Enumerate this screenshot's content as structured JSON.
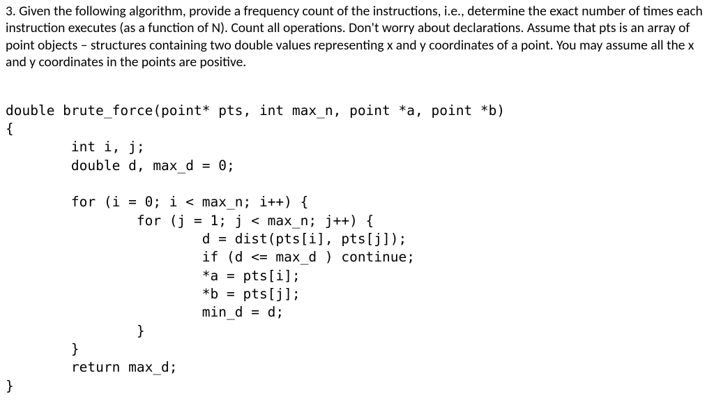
{
  "question": {
    "text": "3. Given the following algorithm,  provide a frequency count of the instructions, i.e., determine the exact number of times each instruction executes (as a function of N). Count all operations. Don't worry about declarations.  Assume that pts is an array of point objects – structures containing two double values representing x and y coordinates of a point. You may assume all the x and y coordinates in the points are positive."
  },
  "code": {
    "lines": [
      "double brute_force(point* pts, int max_n, point *a, point *b)",
      "{",
      "        int i, j;",
      "        double d, max_d = 0;",
      "",
      "        for (i = 0; i < max_n; i++) {",
      "                for (j = 1; j < max_n; j++) {",
      "                        d = dist(pts[i], pts[j]);",
      "                        if (d <= max_d ) continue;",
      "                        *a = pts[i];",
      "                        *b = pts[j];",
      "                        min_d = d;",
      "                }",
      "        }",
      "        return max_d;",
      "}"
    ]
  }
}
